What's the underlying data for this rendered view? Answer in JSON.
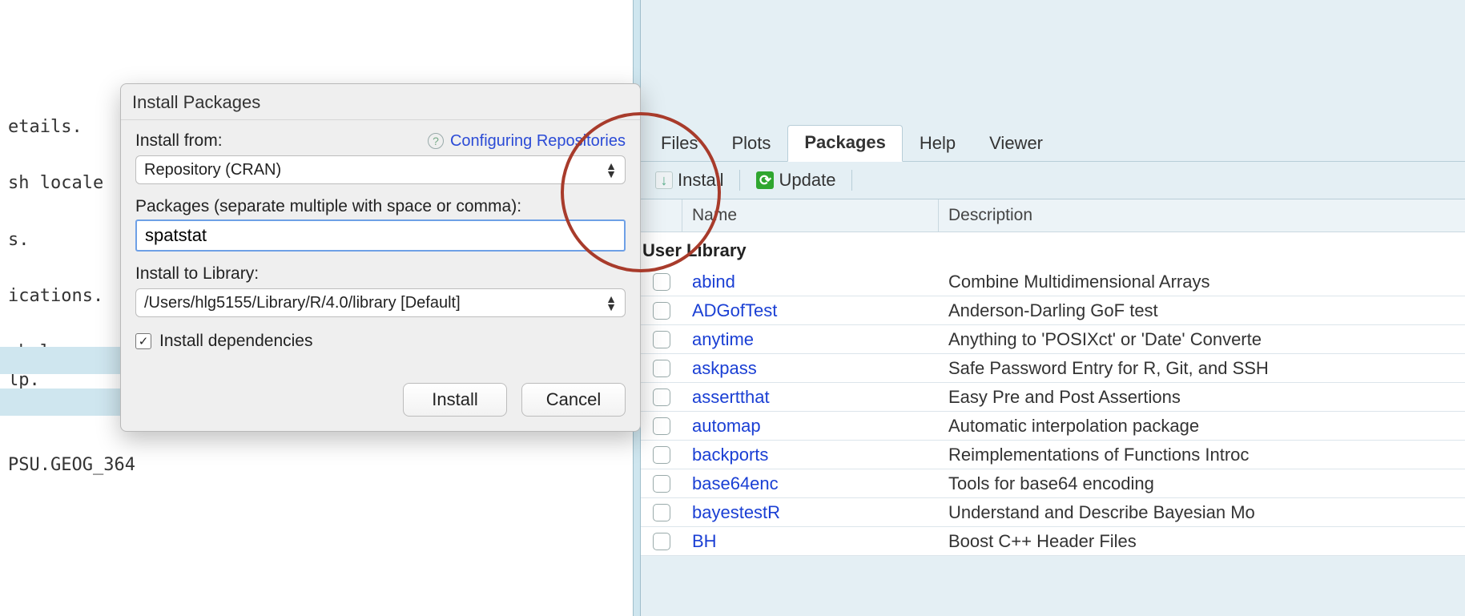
{
  "console": {
    "lines": [
      "etails.",
      "",
      "sh locale",
      "",
      "s.",
      "",
      "ications.",
      "",
      " help, or",
      "lp.",
      "",
      "",
      "PSU.GEOG_364"
    ]
  },
  "dialog": {
    "title": "Install Packages",
    "install_from_label": "Install from:",
    "help_link": "Configuring Repositories",
    "repo_select": "Repository (CRAN)",
    "packages_label": "Packages (separate multiple with space or comma):",
    "packages_value": "spatstat",
    "install_to_label": "Install to Library:",
    "library_select": "/Users/hlg5155/Library/R/4.0/library [Default]",
    "deps_label": "Install dependencies",
    "deps_checked": true,
    "install_btn": "Install",
    "cancel_btn": "Cancel"
  },
  "right": {
    "tabs": [
      "Files",
      "Plots",
      "Packages",
      "Help",
      "Viewer"
    ],
    "active_tab_index": 2,
    "toolbar": {
      "install": "Install",
      "update": "Update"
    },
    "columns": {
      "name": "Name",
      "desc": "Description"
    },
    "section": "User Library",
    "packages": [
      {
        "name": "abind",
        "desc": "Combine Multidimensional Arrays"
      },
      {
        "name": "ADGofTest",
        "desc": "Anderson-Darling GoF test"
      },
      {
        "name": "anytime",
        "desc": "Anything to 'POSIXct' or 'Date' Converte"
      },
      {
        "name": "askpass",
        "desc": "Safe Password Entry for R, Git, and SSH"
      },
      {
        "name": "assertthat",
        "desc": "Easy Pre and Post Assertions"
      },
      {
        "name": "automap",
        "desc": "Automatic interpolation package"
      },
      {
        "name": "backports",
        "desc": "Reimplementations of Functions Introc"
      },
      {
        "name": "base64enc",
        "desc": "Tools for base64 encoding"
      },
      {
        "name": "bayestestR",
        "desc": "Understand and Describe Bayesian Mo"
      },
      {
        "name": "BH",
        "desc": "Boost C++ Header Files"
      }
    ]
  }
}
